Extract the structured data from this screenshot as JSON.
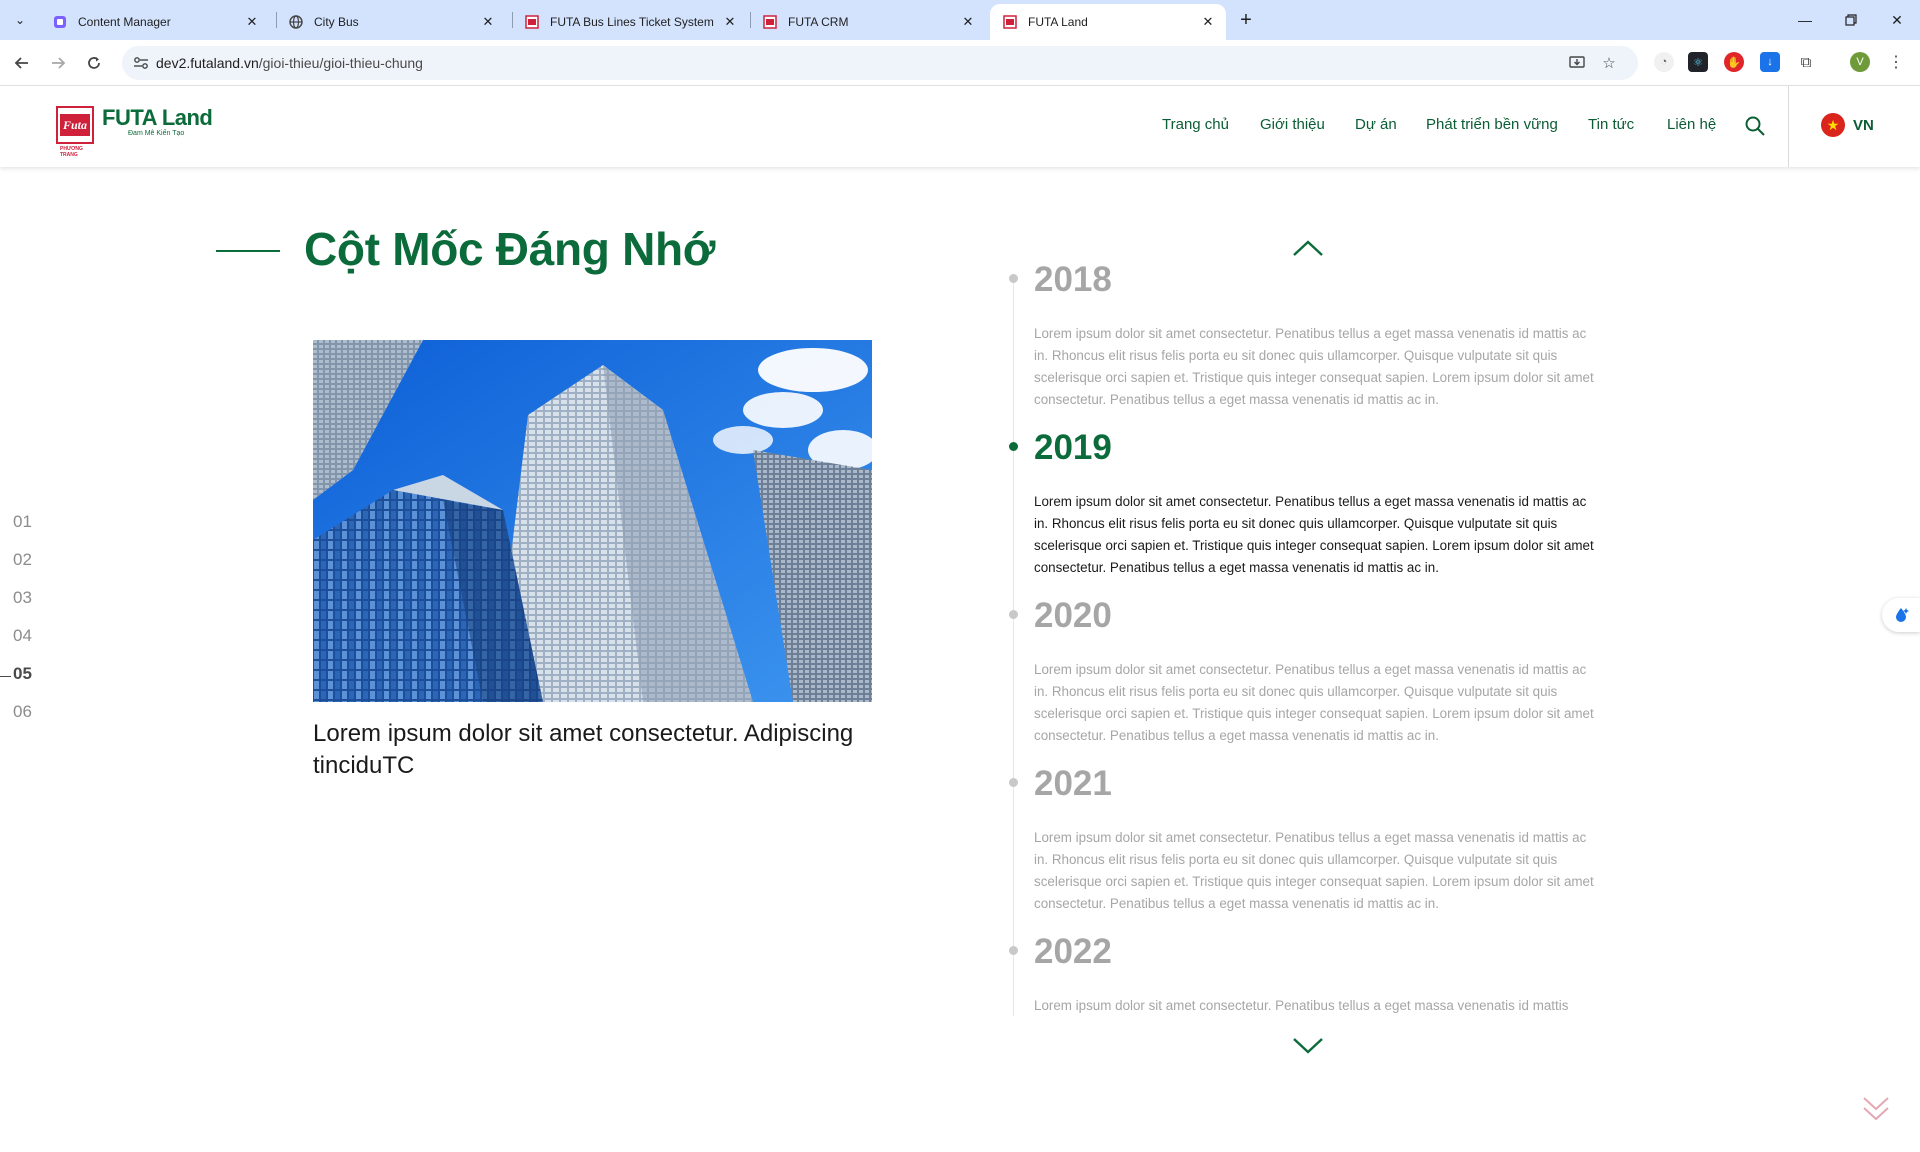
{
  "browser": {
    "tabs": [
      {
        "title": "Content Manager",
        "active": false
      },
      {
        "title": "City Bus",
        "active": false
      },
      {
        "title": "FUTA Bus Lines Ticket System",
        "active": false
      },
      {
        "title": "FUTA CRM",
        "active": false
      },
      {
        "title": "FUTA Land",
        "active": true
      }
    ],
    "url_host": "dev2.futaland.vn",
    "url_path": "/gioi-thieu/gioi-thieu-chung",
    "profile_initial": "V"
  },
  "header": {
    "logo_name_prefix": "FUTA",
    "logo_name_suffix": " Land",
    "logo_tagline": "Đam Mê Kiến Tạo",
    "logo_mark_text": "Futa",
    "logo_sub": "PHƯƠNG TRANG",
    "nav": [
      "Trang chủ",
      "Giới thiệu",
      "Dự án",
      "Phát triển bền vững",
      "Tin tức",
      "Liên hệ"
    ],
    "lang_label": "VN"
  },
  "section": {
    "title": "Cột Mốc Đáng Nhớ",
    "caption": "Lorem ipsum dolor sit amet consectetur. Adipiscing tinciduTC"
  },
  "pager": {
    "items": [
      "01",
      "02",
      "03",
      "04",
      "05",
      "06"
    ],
    "active_index": 4
  },
  "timeline": {
    "active_year": "2019",
    "entries": [
      {
        "year": "2018",
        "text": "Lorem ipsum dolor sit amet consectetur. Penatibus tellus a eget massa venenatis id mattis ac in. Rhoncus elit risus felis porta eu sit donec quis ullamcorper. Quisque vulputate sit quis scelerisque orci sapien et. Tristique quis integer consequat sapien. Lorem ipsum dolor sit amet consectetur. Penatibus tellus a eget massa venenatis id mattis ac in."
      },
      {
        "year": "2019",
        "text": "Lorem ipsum dolor sit amet consectetur. Penatibus tellus a eget massa venenatis id mattis ac in. Rhoncus elit risus felis porta eu sit donec quis ullamcorper. Quisque vulputate sit quis scelerisque orci sapien et. Tristique quis integer consequat sapien. Lorem ipsum dolor sit amet consectetur. Penatibus tellus a eget massa venenatis id mattis ac in."
      },
      {
        "year": "2020",
        "text": "Lorem ipsum dolor sit amet consectetur. Penatibus tellus a eget massa venenatis id mattis ac in. Rhoncus elit risus felis porta eu sit donec quis ullamcorper. Quisque vulputate sit quis scelerisque orci sapien et. Tristique quis integer consequat sapien. Lorem ipsum dolor sit amet consectetur. Penatibus tellus a eget massa venenatis id mattis ac in."
      },
      {
        "year": "2021",
        "text": "Lorem ipsum dolor sit amet consectetur. Penatibus tellus a eget massa venenatis id mattis ac in. Rhoncus elit risus felis porta eu sit donec quis ullamcorper. Quisque vulputate sit quis scelerisque orci sapien et. Tristique quis integer consequat sapien. Lorem ipsum dolor sit amet consectetur. Penatibus tellus a eget massa venenatis id mattis ac in."
      },
      {
        "year": "2022",
        "text": "Lorem ipsum dolor sit amet consectetur. Penatibus tellus a eget massa venenatis id mattis"
      }
    ]
  },
  "colors": {
    "brand_green": "#0b6b3a",
    "brand_red": "#d0213b",
    "muted_text": "#a6a6a6",
    "browser_tab_bg": "#d3e3fd"
  },
  "icons": {
    "search": "search-icon",
    "timeline_up": "chevron-up-icon",
    "timeline_down": "chevron-down-icon",
    "scroll_cue": "double-chevron-down-icon"
  }
}
